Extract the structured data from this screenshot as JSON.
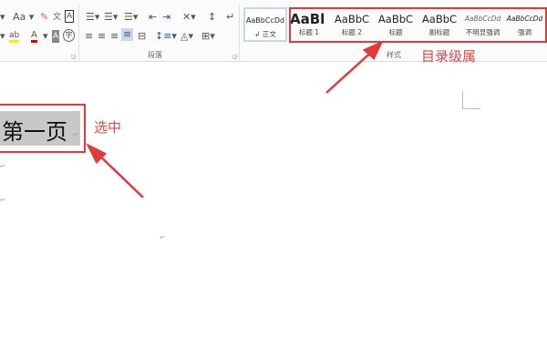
{
  "ribbon": {
    "font_group": {
      "case_button": "Aa",
      "icons": [
        "text-direction-icon",
        "change-case-icon",
        "clear-format-icon",
        "phonetic-guide-icon",
        "char-border-icon",
        "highlight-icon",
        "font-color-icon",
        "char-shading-icon",
        "enclose-char-icon"
      ]
    },
    "paragraph_group": {
      "label": "段落"
    },
    "styles_group": {
      "label": "样式",
      "styles": [
        {
          "preview": "AaBbCcDd",
          "name": "正文",
          "selected": true
        },
        {
          "preview": "AaBl",
          "name": "标题 1"
        },
        {
          "preview": "AaBbC",
          "name": "标题 2"
        },
        {
          "preview": "AaBbC",
          "name": "标题"
        },
        {
          "preview": "AaBbC",
          "name": "副标题"
        },
        {
          "preview": "AaBbCcDd",
          "name": "不明显强调"
        },
        {
          "preview": "AaBbCcDd",
          "name": "强调"
        }
      ]
    }
  },
  "document": {
    "selected_text": "第一页",
    "paragraph_mark": "↵"
  },
  "annotations": {
    "styles_note": "目录级属",
    "selection_note": "选中",
    "color": "#e03a3a"
  }
}
